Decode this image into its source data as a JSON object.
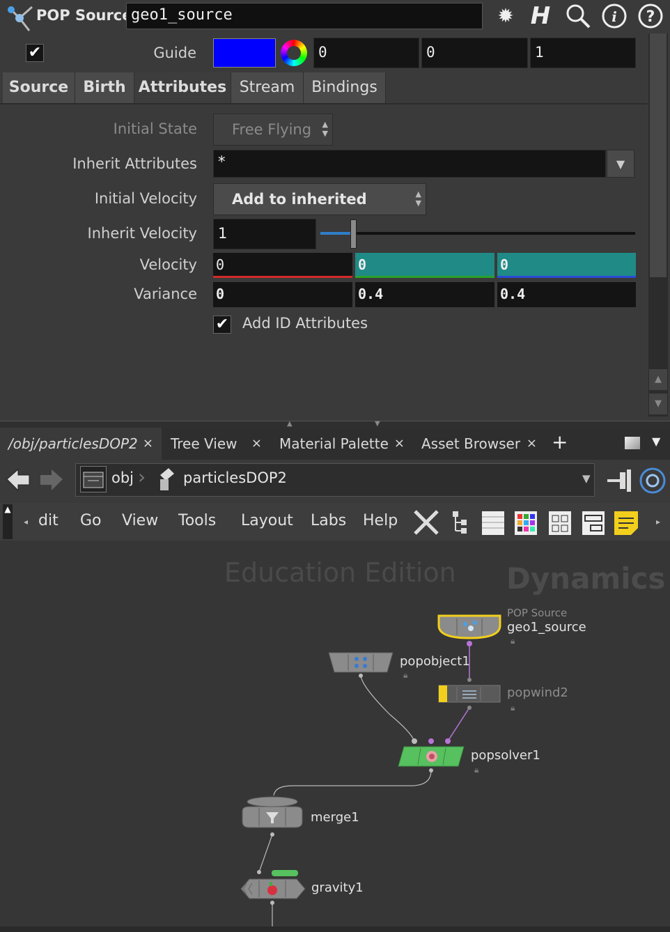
{
  "header": {
    "node_type": "POP Source",
    "node_name": "geo1_source",
    "icons": [
      "gear-icon",
      "houdini-help-icon",
      "search-icon",
      "info-icon",
      "help-icon"
    ]
  },
  "guide": {
    "checked": true,
    "label": "Guide",
    "color": "#0000ff",
    "r": "0",
    "g": "0",
    "b": "1"
  },
  "tabs": [
    "Source",
    "Birth",
    "Attributes",
    "Stream",
    "Bindings"
  ],
  "active_tab": "Attributes",
  "params": {
    "initial_state_label": "Initial State",
    "initial_state_value": "Free Flying",
    "inherit_attrs_label": "Inherit Attributes",
    "inherit_attrs_value": "*",
    "initial_velocity_label": "Initial Velocity",
    "initial_velocity_value": "Add to inherited velocity",
    "inherit_velocity_label": "Inherit Velocity",
    "inherit_velocity_value": "1",
    "velocity_label": "Velocity",
    "velocity": [
      "0",
      "0",
      "0"
    ],
    "variance_label": "Variance",
    "variance": [
      "0",
      "0.4",
      "0.4"
    ],
    "add_id_label": "Add ID Attributes",
    "add_id_checked": true
  },
  "pane_tabs": [
    {
      "label": "/obj/particlesDOP2",
      "close": "×"
    },
    {
      "label": "Tree View",
      "close": "×"
    },
    {
      "label": "Material Palette",
      "close": "×"
    },
    {
      "label": "Asset Browser",
      "close": "×"
    }
  ],
  "add_tab": "+",
  "path": {
    "obj": "obj",
    "node": "particlesDOP2"
  },
  "menu": [
    "dit",
    "Go",
    "View",
    "Tools",
    "Layout",
    "Labs",
    "Help"
  ],
  "network": {
    "watermark_edition": "Education Edition",
    "watermark_context": "Dynamics",
    "nodes": [
      {
        "name": "geo1_source",
        "type": "POP Source"
      },
      {
        "name": "popobject1"
      },
      {
        "name": "popwind2"
      },
      {
        "name": "popsolver1"
      },
      {
        "name": "merge1"
      },
      {
        "name": "gravity1"
      }
    ]
  },
  "colors": {
    "solver_green": "#56c15e",
    "selected_yellow": "#f2cf1c",
    "velocity_y": "#1f8a86",
    "wire_purple": "#b774d6"
  }
}
